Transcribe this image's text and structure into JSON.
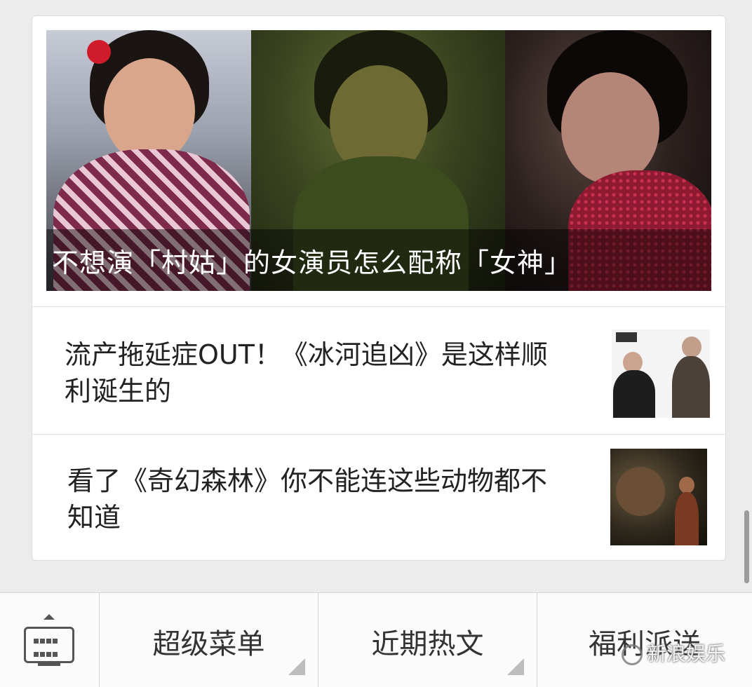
{
  "feed": {
    "hero_article": {
      "title": "不想演「村姑」的女演员怎么配称「女神」"
    },
    "articles": [
      {
        "title": "流产拖延症OUT！《冰河追凶》是这样顺利诞生的"
      },
      {
        "title": "看了《奇幻森林》你不能连这些动物都不知道"
      }
    ]
  },
  "menu_bar": {
    "keyboard_icon": "keyboard-icon",
    "tabs": [
      {
        "label": "超级菜单"
      },
      {
        "label": "近期热文"
      },
      {
        "label": "福利派送"
      }
    ]
  },
  "watermark": {
    "text": "新浪娱乐",
    "icon": "wechat-logo-icon"
  },
  "colors": {
    "background": "#ececec",
    "card": "#ffffff",
    "text": "#222222",
    "menu_text": "#333333"
  }
}
